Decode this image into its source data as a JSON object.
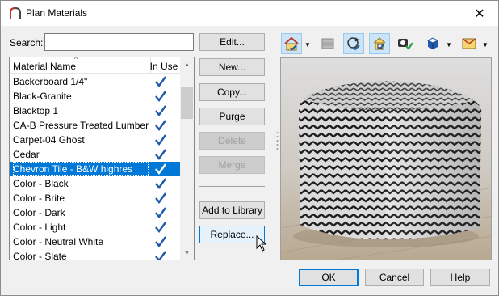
{
  "window": {
    "title": "Plan Materials",
    "close_glyph": "✕"
  },
  "search": {
    "label": "Search:",
    "value": "",
    "placeholder": ""
  },
  "list": {
    "columns": {
      "name": "Material Name",
      "in_use": "In Use"
    },
    "sort_glyph": "^",
    "items": [
      {
        "name": "Backerboard 1/4\"",
        "in_use": true,
        "selected": false
      },
      {
        "name": "Black-Granite",
        "in_use": true,
        "selected": false
      },
      {
        "name": "Blacktop 1",
        "in_use": true,
        "selected": false
      },
      {
        "name": "CA-B Pressure Treated Lumber",
        "in_use": true,
        "selected": false
      },
      {
        "name": "Carpet-04 Ghost",
        "in_use": true,
        "selected": false
      },
      {
        "name": "Cedar",
        "in_use": true,
        "selected": false
      },
      {
        "name": "Chevron Tile - B&W highres",
        "in_use": true,
        "selected": true
      },
      {
        "name": "Color - Black",
        "in_use": true,
        "selected": false
      },
      {
        "name": "Color - Brite",
        "in_use": true,
        "selected": false
      },
      {
        "name": "Color - Dark",
        "in_use": true,
        "selected": false
      },
      {
        "name": "Color - Light",
        "in_use": true,
        "selected": false
      },
      {
        "name": "Color - Neutral White",
        "in_use": true,
        "selected": false
      },
      {
        "name": "Color - Slate",
        "in_use": true,
        "selected": false
      }
    ],
    "scroll_up_glyph": "▲",
    "scroll_down_glyph": "▼"
  },
  "buttons": {
    "edit": "Edit...",
    "new": "New...",
    "copy": "Copy...",
    "purge": "Purge",
    "delete": "Delete",
    "merge": "Merge",
    "add_to_library": "Add to Library",
    "replace": "Replace...",
    "ok": "OK",
    "cancel": "Cancel",
    "help": "Help"
  },
  "toolbar": {
    "icons": [
      "render-mode-icon",
      "flat-view-icon",
      "rotate-view-icon",
      "plan-view-icon",
      "material-camera-icon",
      "cube-shape-icon",
      "box-shape-icon"
    ],
    "dropdown_glyph": "▼"
  },
  "colors": {
    "accent": "#0078d7",
    "selection": "#0078d7",
    "check": "#1e5aa8"
  }
}
